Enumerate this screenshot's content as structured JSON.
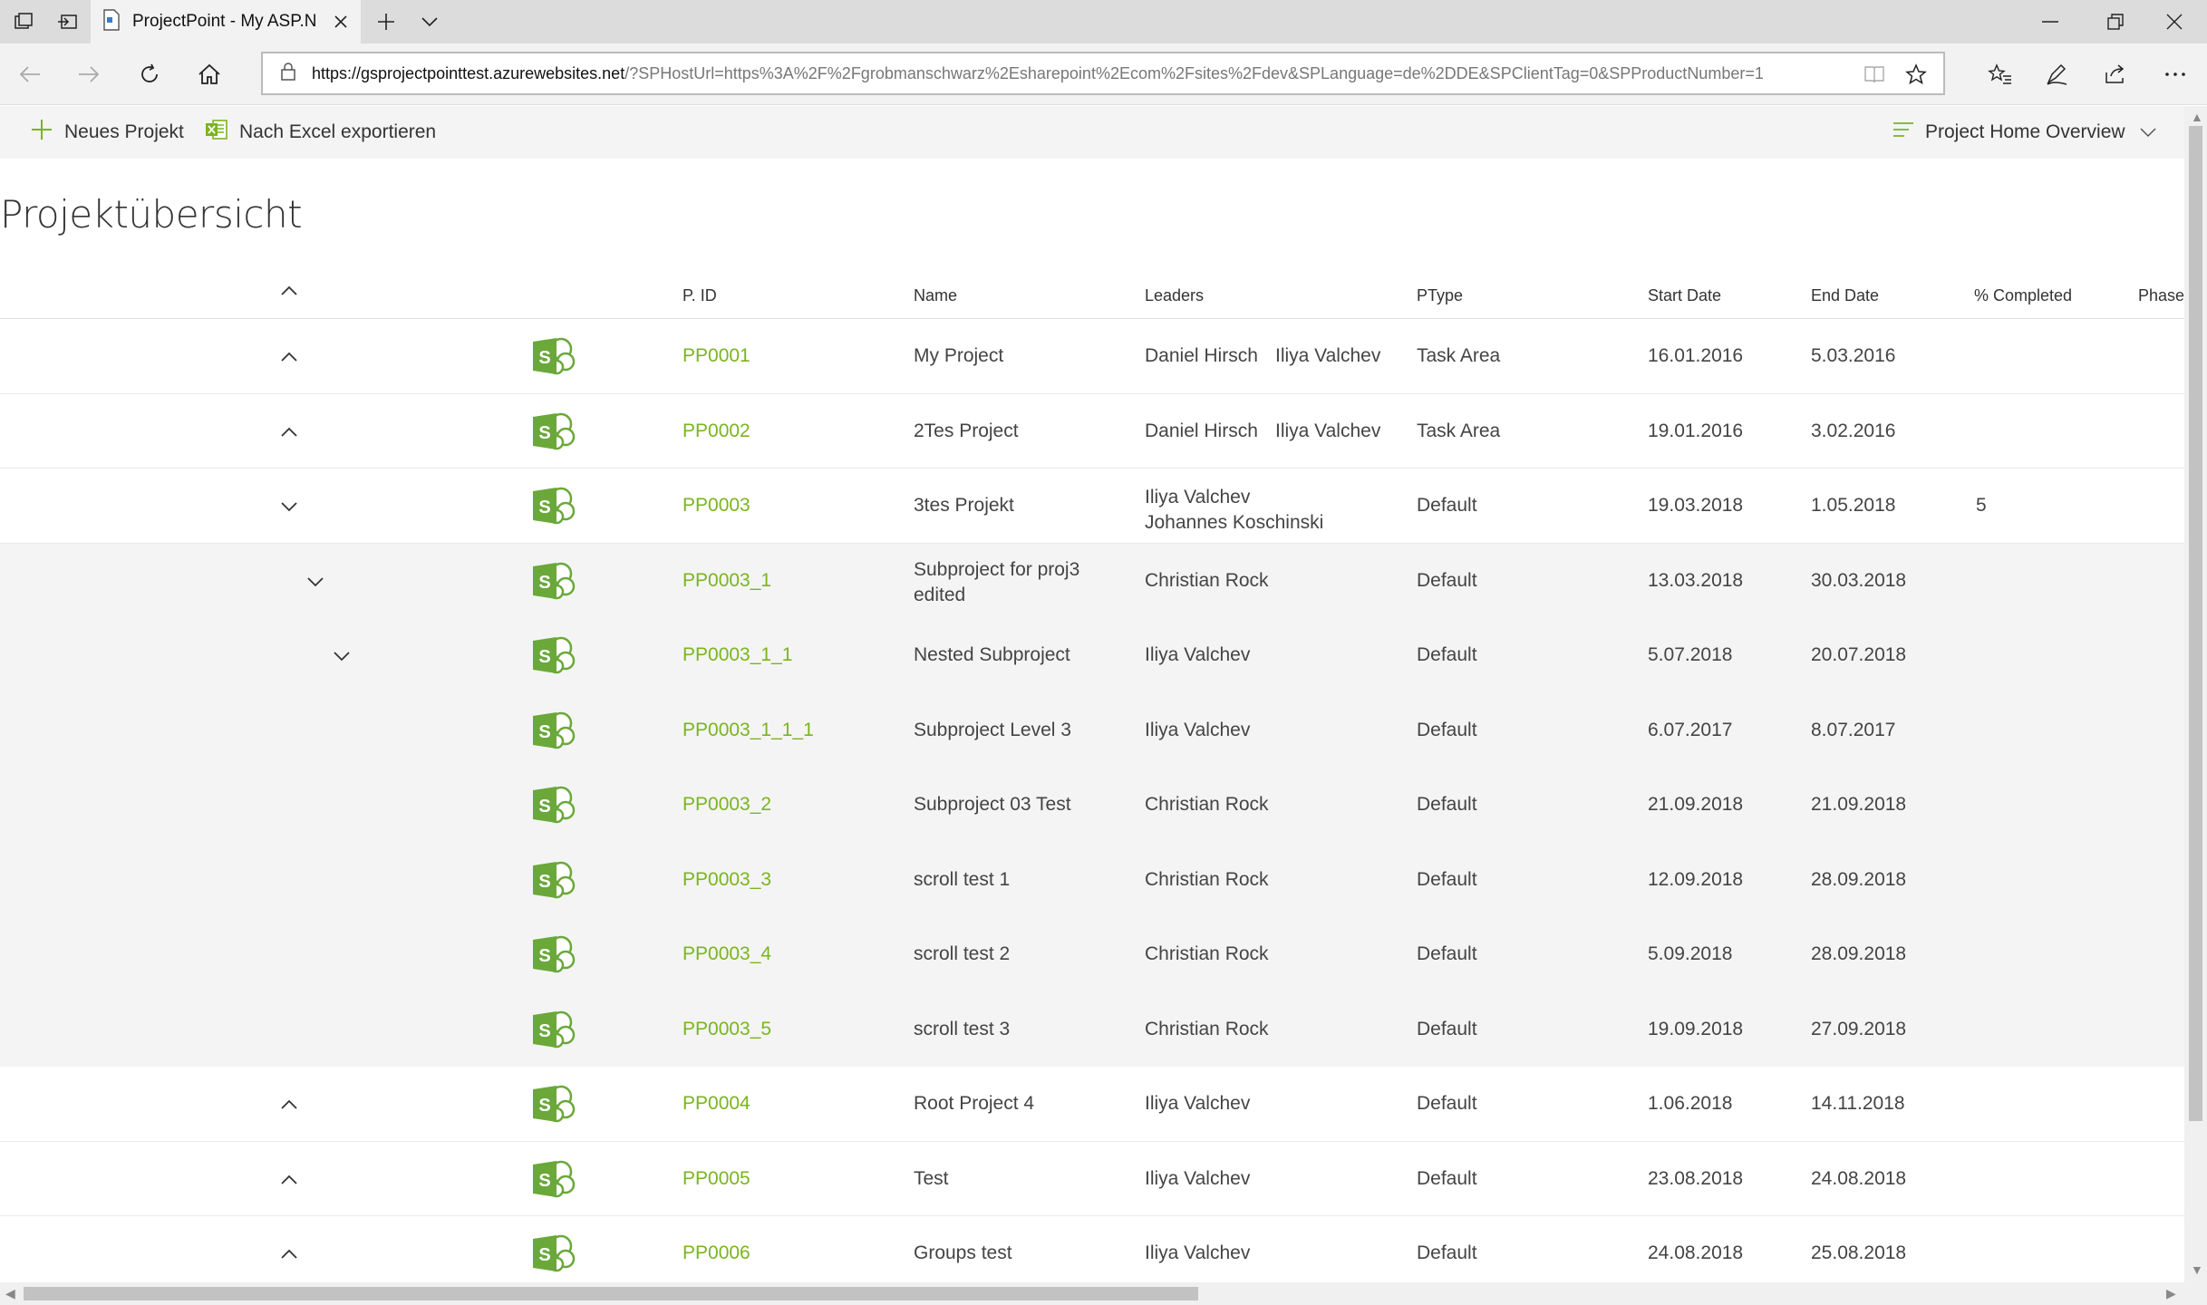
{
  "browser": {
    "tab_title": "ProjectPoint - My ASP.N",
    "address_host": "https://gsprojectpointtest.azurewebsites.net",
    "address_rest": "/?SPHostUrl=https%3A%2F%2Fgrobmanschwarz%2Esharepoint%2Ecom%2Fsites%2Fdev&SPLanguage=de%2DDE&SPClientTag=0&SPProductNumber=1"
  },
  "commands": {
    "new_project": "Neues Projekt",
    "export_excel": "Nach Excel exportieren",
    "view_selector": "Project Home Overview"
  },
  "page_title": "Projektübersicht",
  "columns": {
    "pid": "P. ID",
    "name": "Name",
    "leaders": "Leaders",
    "ptype": "PType",
    "start": "Start Date",
    "end": "End Date",
    "completed": "% Completed",
    "phase": "Phase"
  },
  "rows": [
    {
      "pid": "PP0001",
      "name": "My Project",
      "name2": "",
      "leader1": "Daniel Hirsch",
      "leader2": "Iliya Valchev",
      "leader3": "",
      "ptype": "Task Area",
      "start": "16.01.2016",
      "end": "5.03.2016",
      "completed": ""
    },
    {
      "pid": "PP0002",
      "name": "2Tes Project",
      "name2": "",
      "leader1": "Daniel Hirsch",
      "leader2": "Iliya Valchev",
      "leader3": "",
      "ptype": "Task Area",
      "start": "19.01.2016",
      "end": "3.02.2016",
      "completed": ""
    },
    {
      "pid": "PP0003",
      "name": "3tes Projekt",
      "name2": "",
      "leader1": "Iliya Valchev",
      "leader2": "Johannes Koschinski",
      "leader3": "",
      "ptype": "Default",
      "start": "19.03.2018",
      "end": "1.05.2018",
      "completed": "5"
    },
    {
      "pid": "PP0003_1",
      "name": "Subproject for proj3",
      "name2": "edited",
      "leader1": "Christian Rock",
      "leader2": "",
      "leader3": "",
      "ptype": "Default",
      "start": "13.03.2018",
      "end": "30.03.2018",
      "completed": ""
    },
    {
      "pid": "PP0003_1_1",
      "name": "Nested Subproject",
      "name2": "",
      "leader1": "Iliya Valchev",
      "leader2": "",
      "leader3": "",
      "ptype": "Default",
      "start": "5.07.2018",
      "end": "20.07.2018",
      "completed": ""
    },
    {
      "pid": "PP0003_1_1_1",
      "name": "Subproject Level 3",
      "name2": "",
      "leader1": "Iliya Valchev",
      "leader2": "",
      "leader3": "",
      "ptype": "Default",
      "start": "6.07.2017",
      "end": "8.07.2017",
      "completed": ""
    },
    {
      "pid": "PP0003_2",
      "name": "Subproject 03 Test",
      "name2": "",
      "leader1": "Christian Rock",
      "leader2": "",
      "leader3": "",
      "ptype": "Default",
      "start": "21.09.2018",
      "end": "21.09.2018",
      "completed": ""
    },
    {
      "pid": "PP0003_3",
      "name": "scroll test 1",
      "name2": "",
      "leader1": "Christian Rock",
      "leader2": "",
      "leader3": "",
      "ptype": "Default",
      "start": "12.09.2018",
      "end": "28.09.2018",
      "completed": ""
    },
    {
      "pid": "PP0003_4",
      "name": "scroll test 2",
      "name2": "",
      "leader1": "Christian Rock",
      "leader2": "",
      "leader3": "",
      "ptype": "Default",
      "start": "5.09.2018",
      "end": "28.09.2018",
      "completed": ""
    },
    {
      "pid": "PP0003_5",
      "name": "scroll test 3",
      "name2": "",
      "leader1": "Christian Rock",
      "leader2": "",
      "leader3": "",
      "ptype": "Default",
      "start": "19.09.2018",
      "end": "27.09.2018",
      "completed": ""
    },
    {
      "pid": "PP0004",
      "name": "Root Project 4",
      "name2": "",
      "leader1": "Iliya Valchev",
      "leader2": "",
      "leader3": "",
      "ptype": "Default",
      "start": "1.06.2018",
      "end": "14.11.2018",
      "completed": ""
    },
    {
      "pid": "PP0005",
      "name": "Test",
      "name2": "",
      "leader1": "Iliya Valchev",
      "leader2": "",
      "leader3": "",
      "ptype": "Default",
      "start": "23.08.2018",
      "end": "24.08.2018",
      "completed": ""
    },
    {
      "pid": "PP0006",
      "name": "Groups test",
      "name2": "",
      "leader1": "Iliya Valchev",
      "leader2": "",
      "leader3": "",
      "ptype": "Default",
      "start": "24.08.2018",
      "end": "25.08.2018",
      "completed": ""
    }
  ],
  "colors": {
    "accent_green": "#7ab51d",
    "sharepoint_green": "#6aa83a"
  }
}
